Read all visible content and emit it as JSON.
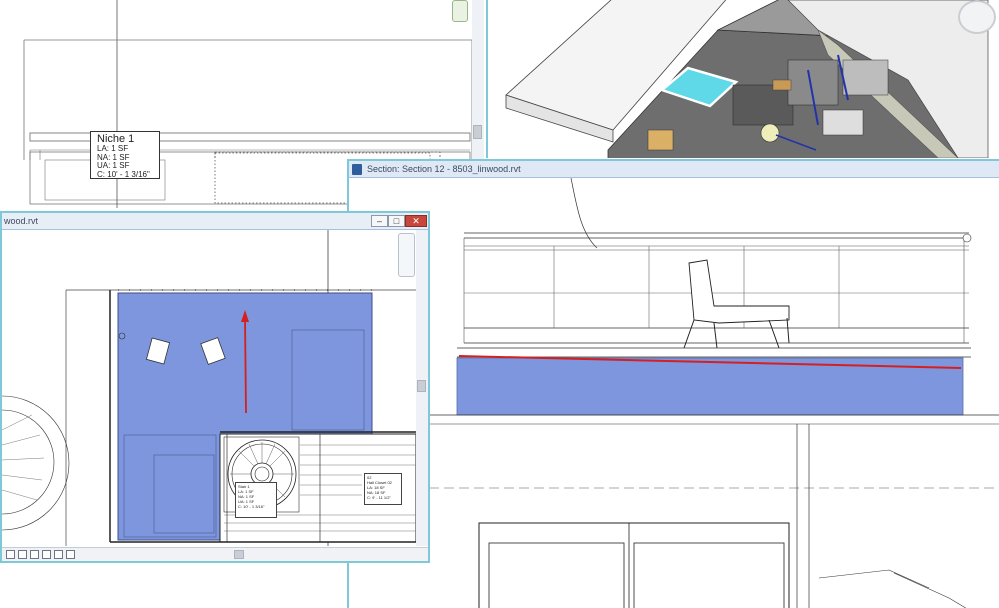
{
  "windows": {
    "plan_top": {
      "scroll_icon": "nav-bar-icon"
    },
    "view3d": {
      "viewcube": "viewcube-icon"
    },
    "section": {
      "title": "Section: Section 12 - 8503_linwood.rvt"
    },
    "floor_plan": {
      "title": "wood.rvt",
      "minimize": "–",
      "maximize": "□",
      "close": "✕"
    }
  },
  "niche_tag": {
    "title": "Niche 1",
    "lines": [
      "LA: 1 SF",
      "NA: 1 SF",
      "UA: 1 SF",
      "C: 10' - 1 3/16\""
    ]
  },
  "plan_tags": {
    "stair": [
      "Stair 1",
      "LA: 1 SF",
      "NA: 1 SF",
      "UA: 1 SF",
      "C: 10' - 1 3/16\""
    ],
    "closet": [
      "02",
      "Hall Closet 02",
      "LA: 18 SF",
      "NA: 18 SF",
      "UA: 18 SF",
      "C: 9' - 11 1/2\""
    ]
  },
  "colors": {
    "selection_fill": "#7d96dd",
    "arrow_red": "#d42020",
    "pool": "#5fd8e8",
    "window_frame": "#7fc8d8"
  }
}
